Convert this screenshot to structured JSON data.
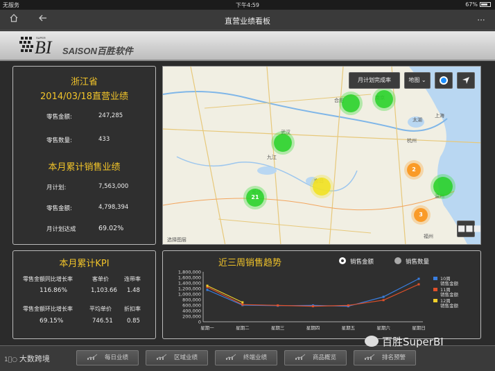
{
  "status": {
    "carrier": "无服务",
    "time": "下午4:59",
    "battery": "67%"
  },
  "nav": {
    "title": "直营业绩看板"
  },
  "logo": {
    "sub": "SUPER",
    "brand": "SAISON百胜软件"
  },
  "summary": {
    "province": "浙江省",
    "heading": "2014/03/18直营业绩",
    "sales_label": "零售金额:",
    "sales_value": "247,285",
    "qty_label": "零售数量:",
    "qty_value": "433",
    "month_heading": "本月累计销售业绩",
    "plan_label": "月计划:",
    "plan_value": "7,563,000",
    "msales_label": "零售金额:",
    "msales_value": "4,798,394",
    "rate_label": "月计划达成",
    "rate_value": "69.02%"
  },
  "map": {
    "dropdown_label": "月计划完成率",
    "layer_label": "地图",
    "credit": "选择图层",
    "clusters": [
      "",
      "",
      "",
      "21",
      "",
      "2",
      "",
      "3"
    ],
    "cities": [
      "合肥",
      "南京",
      "上海",
      "太湖",
      "杭州",
      "南昌",
      "长沙",
      "武汉",
      "九江",
      "福州",
      "温州"
    ]
  },
  "kpi": {
    "title": "本月累计KPI",
    "h1": "零售金额同比增长率",
    "h2": "客单价",
    "h3": "连带率",
    "v1": "116.86%",
    "v2": "1,103.66",
    "v3": "1.48",
    "h4": "零售金额环比增长率",
    "h5": "平均单价",
    "h6": "折扣率",
    "v4": "69.15%",
    "v5": "746.51",
    "v6": "0.85"
  },
  "trend": {
    "title": "近三周销售趋势",
    "radio1": "销售金额",
    "radio2": "销售数量"
  },
  "chart_data": {
    "type": "line",
    "title": "近三周销售趋势",
    "categories": [
      "星期一",
      "星期二",
      "星期三",
      "星期四",
      "星期五",
      "星期六",
      "星期日"
    ],
    "ylim": [
      0,
      1800000
    ],
    "yticks": [
      "1,800,000",
      "1,600,000",
      "1,400,000",
      "1,200,000",
      "1,000,000",
      "800,000",
      "600,000",
      "400,000",
      "200,000",
      "0"
    ],
    "series": [
      {
        "name": "10周销售金额",
        "color": "#3a7ee0",
        "values": [
          1150000,
          600000,
          580000,
          590000,
          560000,
          900000,
          1550000
        ]
      },
      {
        "name": "11周销售金额",
        "color": "#e0502a",
        "values": [
          1250000,
          620000,
          590000,
          560000,
          590000,
          780000,
          1350000
        ]
      },
      {
        "name": "12周销售金额",
        "color": "#f2d02a",
        "values": [
          1300000,
          700000,
          0,
          0,
          0,
          0,
          0
        ]
      }
    ],
    "legend_labels": [
      "10周\n销售金额",
      "11周\n销售金额",
      "12周\n销售金额"
    ],
    "grid": false,
    "legend_position": "right"
  },
  "watermark": {
    "left": "大数跨境",
    "right": "百胜SuperBI"
  },
  "tabs": [
    "每日业绩",
    "区域业绩",
    "终端业绩",
    "商品概览",
    "排名预警"
  ]
}
